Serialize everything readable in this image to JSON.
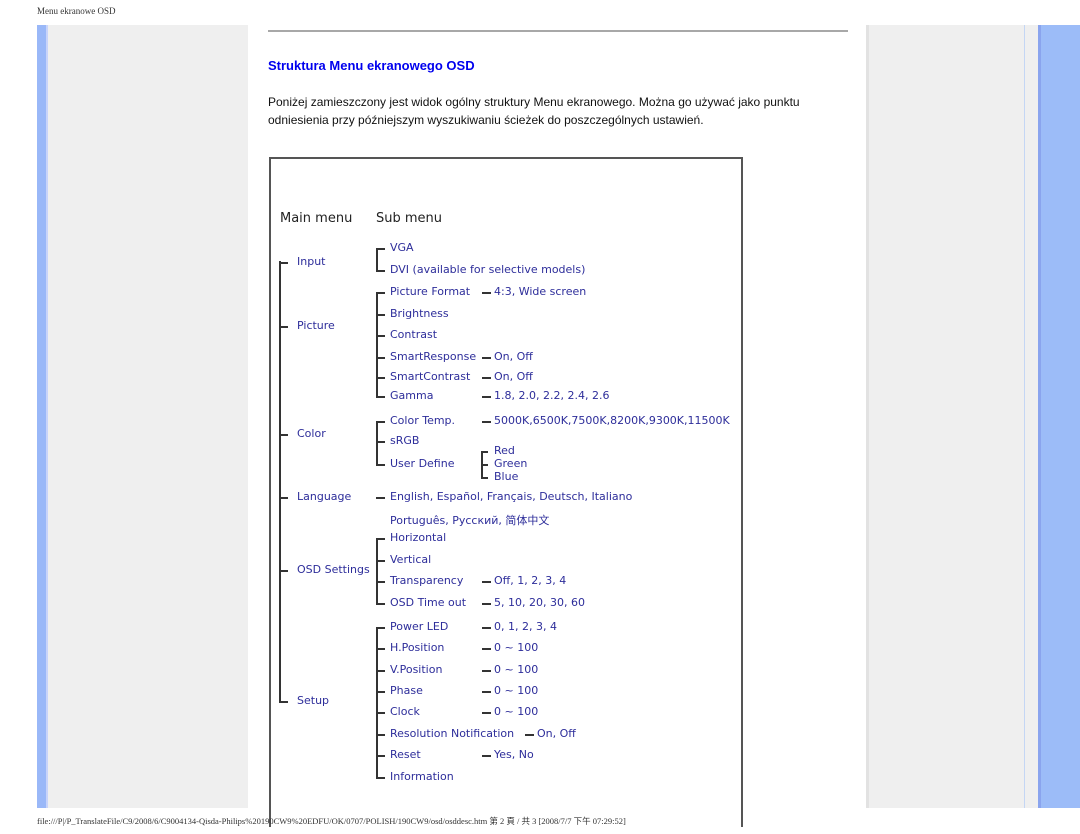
{
  "header": {
    "title": "Menu ekranowe OSD"
  },
  "section": {
    "title": "Struktura Menu ekranowego OSD",
    "intro": "Poniżej zamieszczony jest widok ogólny struktury Menu ekranowego. Można go używać jako punktu odniesienia przy późniejszym wyszukiwaniu ścieżek do poszczególnych ustawień."
  },
  "diagram": {
    "col_main": "Main menu",
    "col_sub": "Sub menu",
    "main": [
      "Input",
      "Picture",
      "Color",
      "Language",
      "OSD Settings",
      "Setup"
    ],
    "input": [
      "VGA",
      "DVI (available for selective models)"
    ],
    "picture": [
      {
        "label": "Picture Format",
        "value": "4:3, Wide screen"
      },
      {
        "label": "Brightness",
        "value": ""
      },
      {
        "label": "Contrast",
        "value": ""
      },
      {
        "label": "SmartResponse",
        "value": "On, Off"
      },
      {
        "label": "SmartContrast",
        "value": "On, Off"
      },
      {
        "label": "Gamma",
        "value": "1.8, 2.0, 2.2, 2.4, 2.6"
      }
    ],
    "color": [
      {
        "label": "Color Temp.",
        "value": "5000K,6500K,7500K,8200K,9300K,11500K"
      },
      {
        "label": "sRGB",
        "value": ""
      },
      {
        "label": "User Define",
        "value": ""
      }
    ],
    "user_define": [
      "Red",
      "Green",
      "Blue"
    ],
    "language": [
      "English, Español, Français, Deutsch, Italiano",
      "Português, Русский, 简体中文"
    ],
    "osd": [
      {
        "label": "Horizontal",
        "value": ""
      },
      {
        "label": "Vertical",
        "value": ""
      },
      {
        "label": "Transparency",
        "value": "Off, 1, 2, 3, 4"
      },
      {
        "label": "OSD Time out",
        "value": "5, 10, 20, 30, 60"
      }
    ],
    "setup": [
      {
        "label": "Power LED",
        "value": "0, 1, 2, 3, 4"
      },
      {
        "label": "H.Position",
        "value": "0 ~ 100"
      },
      {
        "label": "V.Position",
        "value": "0 ~ 100"
      },
      {
        "label": "Phase",
        "value": "0 ~ 100"
      },
      {
        "label": "Clock",
        "value": "0 ~ 100"
      },
      {
        "label": "Resolution Notification",
        "value": "On, Off"
      },
      {
        "label": "Reset",
        "value": "Yes, No"
      },
      {
        "label": "Information",
        "value": ""
      }
    ]
  },
  "footer": {
    "path": "file:///P|/P_TranslateFile/C9/2008/6/C9004134-Qisda-Philips%20190CW9%20EDFU/OK/0707/POLISH/190CW9/osd/osddesc.htm 第 2 頁 / 共 3  [2008/7/7 下午 07:29:52]"
  }
}
